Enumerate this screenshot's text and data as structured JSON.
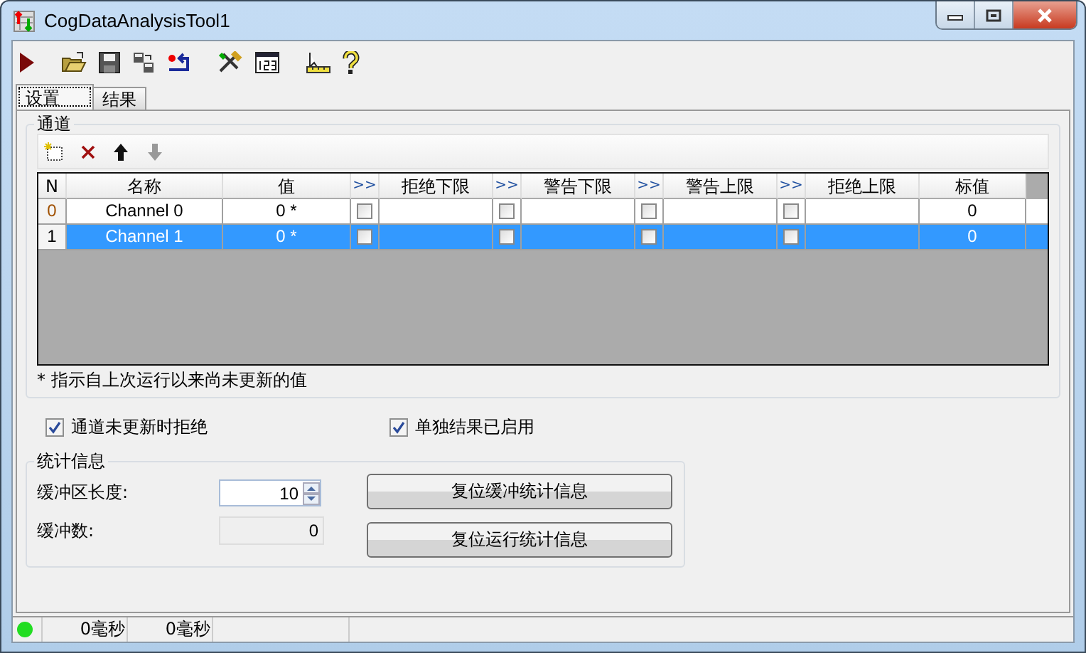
{
  "window": {
    "title": "CogDataAnalysisTool1"
  },
  "tabs": [
    {
      "label": "设置",
      "selected": true
    },
    {
      "label": "结果",
      "selected": false
    }
  ],
  "channels": {
    "title": "通道",
    "columns": [
      "N",
      "名称",
      "值",
      ">>",
      "拒绝下限",
      ">>",
      "警告下限",
      ">>",
      "警告上限",
      ">>",
      "拒绝上限",
      "标值"
    ],
    "rows": [
      {
        "n": "0",
        "name": "Channel 0",
        "value": "0 *",
        "checks": [
          false,
          false,
          false,
          false
        ],
        "nominal": "0",
        "selected": false
      },
      {
        "n": "1",
        "name": "Channel 1",
        "value": "0 *",
        "checks": [
          false,
          false,
          false,
          false
        ],
        "nominal": "0",
        "selected": true
      }
    ],
    "footnote": "* 指示自上次运行以来尚未更新的值"
  },
  "options": [
    {
      "label": "通道未更新时拒绝",
      "checked": true
    },
    {
      "label": "单独结果已启用",
      "checked": true
    }
  ],
  "statistics": {
    "title": "统计信息",
    "buffer_length": {
      "label": "缓冲区长度:",
      "value": "10"
    },
    "buffer_count": {
      "label": "缓冲数:",
      "value": "0"
    },
    "buttons": [
      "复位缓冲统计信息",
      "复位运行统计信息"
    ]
  },
  "status_bar": {
    "ok": true,
    "times": [
      "0毫秒",
      "0毫秒"
    ]
  }
}
